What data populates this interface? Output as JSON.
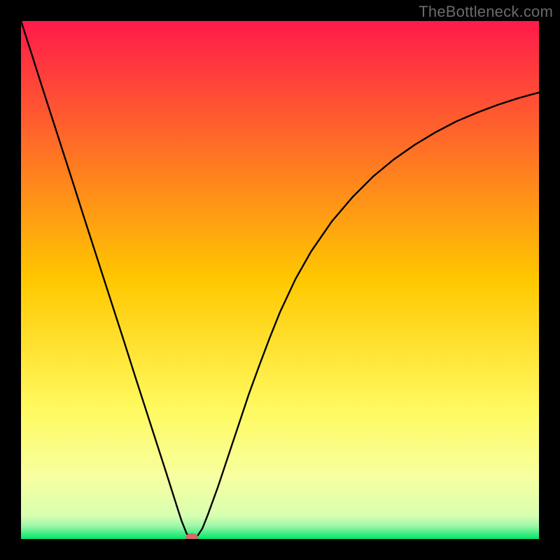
{
  "watermark": "TheBottleneck.com",
  "chart_data": {
    "type": "line",
    "title": "",
    "xlabel": "",
    "ylabel": "",
    "xlim": [
      0,
      100
    ],
    "ylim": [
      0,
      100
    ],
    "grid": false,
    "background_gradient": {
      "stops": [
        {
          "offset": 0.0,
          "color": "#ff1a4b"
        },
        {
          "offset": 0.5,
          "color": "#ffc800"
        },
        {
          "offset": 0.75,
          "color": "#fffa60"
        },
        {
          "offset": 0.88,
          "color": "#f7ffa0"
        },
        {
          "offset": 0.955,
          "color": "#d8ffb0"
        },
        {
          "offset": 0.975,
          "color": "#9cf7a8"
        },
        {
          "offset": 1.0,
          "color": "#00e56a"
        }
      ]
    },
    "series": [
      {
        "name": "bottleneck-curve",
        "color": "#000000",
        "x": [
          0.0,
          2.0,
          4.0,
          6.0,
          8.0,
          10.0,
          12.0,
          14.0,
          16.0,
          18.0,
          20.0,
          22.0,
          24.0,
          26.0,
          28.0,
          30.0,
          31.0,
          32.0,
          33.0,
          34.0,
          35.0,
          36.0,
          38.0,
          40.0,
          42.0,
          44.0,
          46.0,
          48.0,
          50.0,
          53.0,
          56.0,
          60.0,
          64.0,
          68.0,
          72.0,
          76.0,
          80.0,
          84.0,
          88.0,
          92.0,
          96.0,
          100.0
        ],
        "y": [
          100.0,
          93.8,
          87.5,
          81.3,
          75.1,
          68.9,
          62.6,
          56.4,
          50.2,
          44.0,
          37.8,
          31.5,
          25.3,
          19.1,
          12.9,
          6.6,
          3.5,
          1.0,
          0.3,
          0.5,
          2.0,
          4.5,
          10.0,
          16.0,
          22.0,
          28.0,
          33.5,
          38.8,
          43.8,
          50.2,
          55.5,
          61.3,
          66.0,
          70.0,
          73.3,
          76.1,
          78.5,
          80.6,
          82.3,
          83.8,
          85.1,
          86.2
        ]
      }
    ],
    "marker": {
      "name": "optimal-point",
      "x": 33.0,
      "y": 0.3,
      "color": "#d46a6a",
      "rx": 9,
      "ry": 6
    }
  }
}
